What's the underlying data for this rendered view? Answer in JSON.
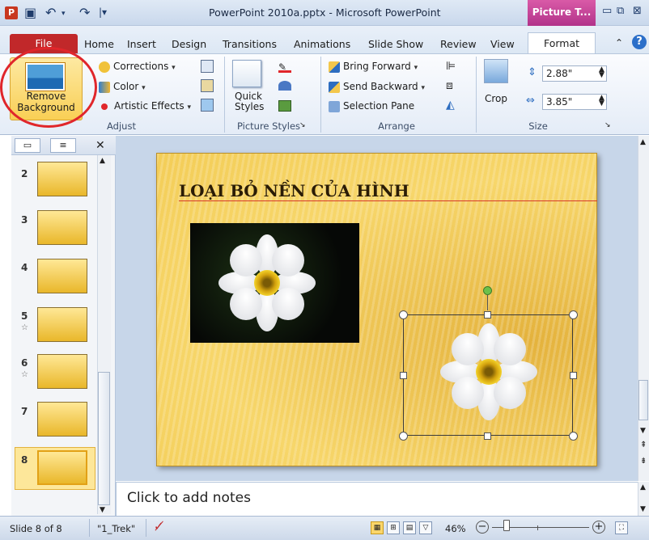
{
  "titlebar": {
    "title": "PowerPoint 2010a.pptx  -  Microsoft PowerPoint",
    "context_tab": "Picture T...",
    "app_icon": "P"
  },
  "tabs": {
    "file": "File",
    "items": [
      "Home",
      "Insert",
      "Design",
      "Transitions",
      "Animations",
      "Slide Show",
      "Review",
      "View"
    ],
    "active": "Format"
  },
  "ribbon": {
    "adjust": {
      "remove_bg": "Remove Background",
      "corrections": "Corrections",
      "color": "Color",
      "artistic": "Artistic Effects",
      "label": "Adjust"
    },
    "styles": {
      "quick_styles": "Quick Styles",
      "label": "Picture Styles"
    },
    "arrange": {
      "bring_forward": "Bring Forward",
      "send_backward": "Send Backward",
      "selection_pane": "Selection Pane",
      "label": "Arrange"
    },
    "size": {
      "crop": "Crop",
      "height": "2.88\"",
      "width": "3.85\"",
      "label": "Size"
    }
  },
  "slides": [
    {
      "num": "2",
      "star": false
    },
    {
      "num": "3",
      "star": false
    },
    {
      "num": "4",
      "star": false
    },
    {
      "num": "5",
      "star": true
    },
    {
      "num": "6",
      "star": true
    },
    {
      "num": "7",
      "star": false
    },
    {
      "num": "8",
      "star": false,
      "selected": true
    }
  ],
  "slide": {
    "title": "LOẠI BỎ NỀN CỦA HÌNH"
  },
  "notes": {
    "placeholder": "Click to add notes"
  },
  "status": {
    "slide_info": "Slide 8 of 8",
    "theme": "\"1_Trek\"",
    "zoom": "46%"
  },
  "colors": {
    "file_tab": "#c1282a",
    "context_tab": "#b2338a",
    "selection_circle": "#e0262b"
  }
}
